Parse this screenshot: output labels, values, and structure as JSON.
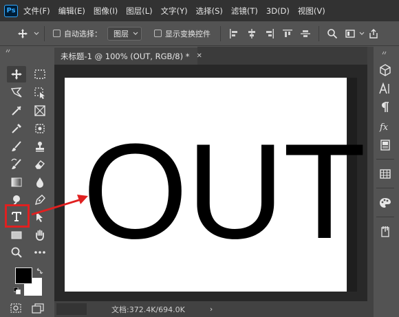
{
  "app": {
    "logo": "Ps"
  },
  "menu": [
    "文件(F)",
    "编辑(E)",
    "图像(I)",
    "图层(L)",
    "文字(Y)",
    "选择(S)",
    "滤镜(T)",
    "3D(D)",
    "视图(V)"
  ],
  "options": {
    "auto_select_label": "自动选择：",
    "auto_select_value": "图层",
    "transform_controls_label": "显示变换控件"
  },
  "document": {
    "tab_title": "未标题-1 @ 100% (OUT, RGB/8) *",
    "canvas_text": "OUT",
    "status": "文档:372.4K/694.0K"
  },
  "colors": {
    "foreground": "#000000",
    "background": "#ffffff",
    "highlight": "#e02020"
  },
  "icons": {
    "active_tool": "type-tool-icon",
    "annotation": "red-arrow"
  }
}
